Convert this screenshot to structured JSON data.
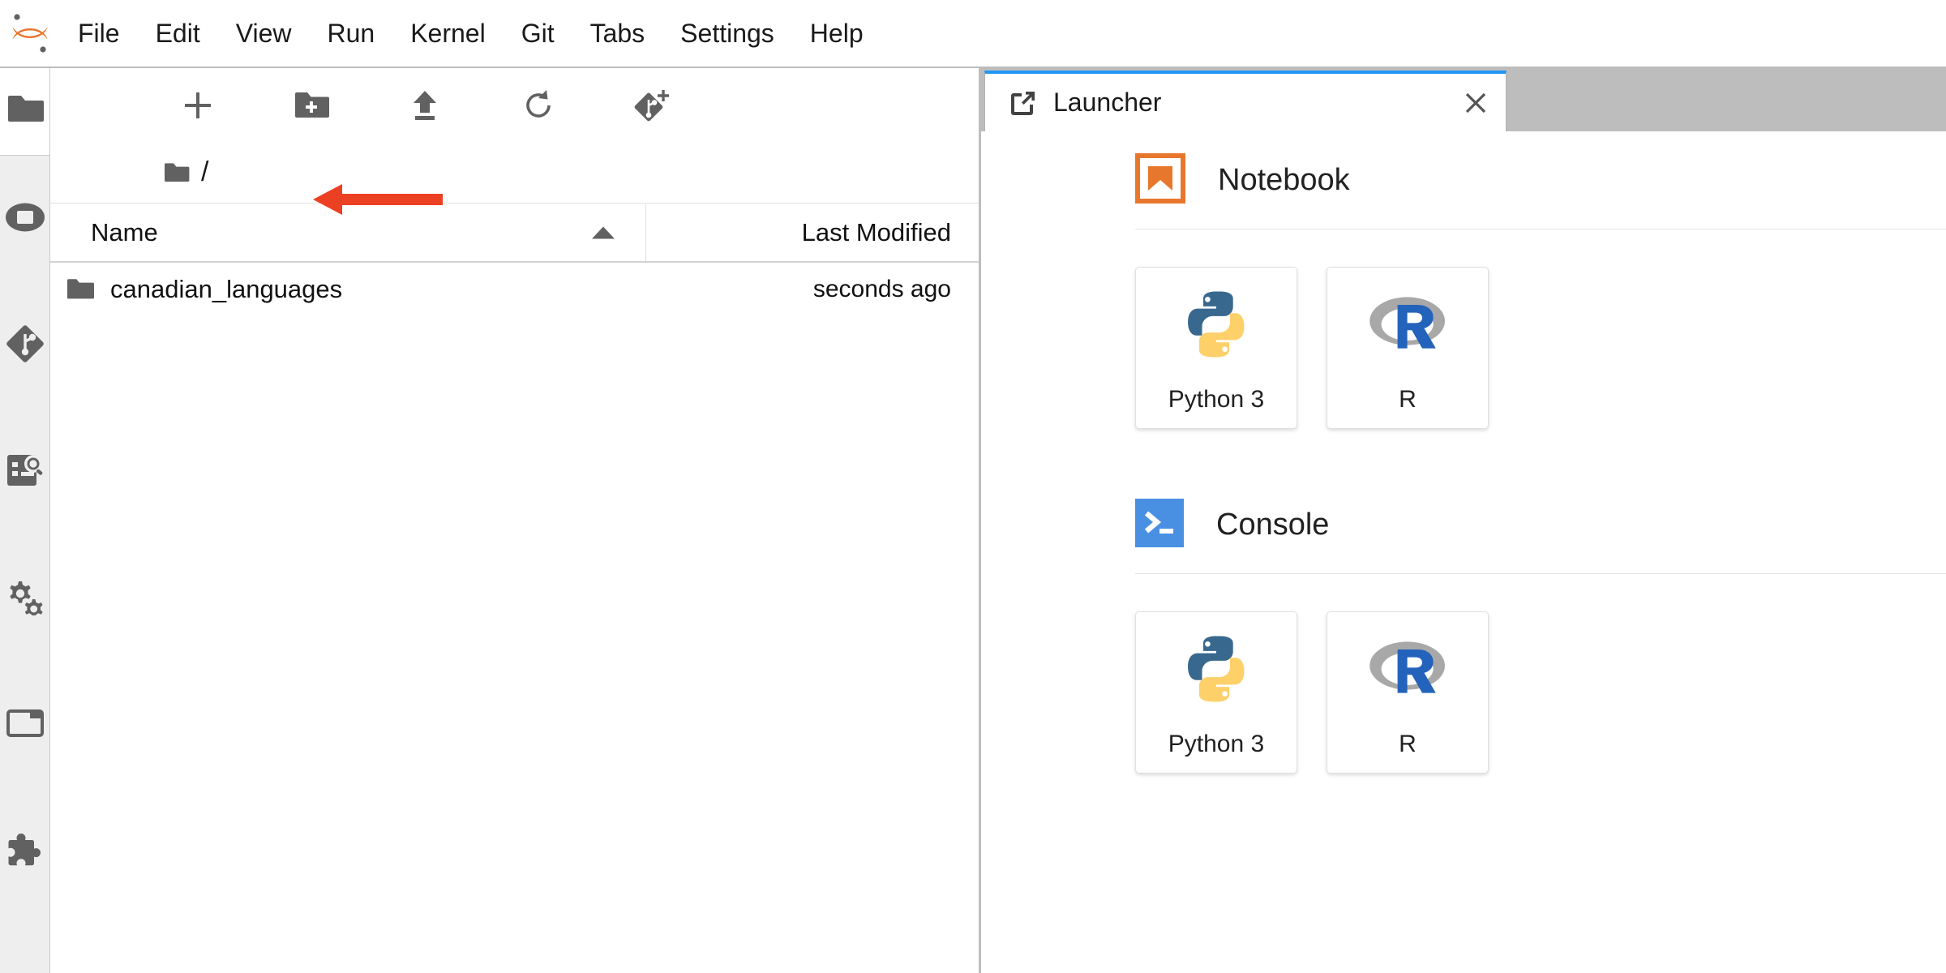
{
  "app": {
    "name": "JupyterLab",
    "logo_color": "#e8772e"
  },
  "menubar": {
    "items": [
      {
        "label": "File"
      },
      {
        "label": "Edit"
      },
      {
        "label": "View"
      },
      {
        "label": "Run"
      },
      {
        "label": "Kernel"
      },
      {
        "label": "Git"
      },
      {
        "label": "Tabs"
      },
      {
        "label": "Settings"
      },
      {
        "label": "Help"
      }
    ]
  },
  "activitybar": {
    "items": [
      {
        "name": "file-browser",
        "icon": "folder-icon",
        "active": true
      },
      {
        "name": "running-terminals",
        "icon": "running-icon",
        "active": false
      },
      {
        "name": "git",
        "icon": "git-icon",
        "active": false
      },
      {
        "name": "debugger",
        "icon": "table-of-contents-search-icon",
        "active": false
      },
      {
        "name": "property-inspector",
        "icon": "gear-icon",
        "active": false
      },
      {
        "name": "tab-manager",
        "icon": "tab-icon",
        "active": false
      },
      {
        "name": "extension-manager",
        "icon": "puzzle-icon",
        "active": false
      }
    ]
  },
  "filebrowser": {
    "toolbar": [
      {
        "name": "new-launcher",
        "icon": "plus-icon",
        "title": "New Launcher"
      },
      {
        "name": "new-folder",
        "icon": "new-folder-icon",
        "title": "New Folder"
      },
      {
        "name": "upload",
        "icon": "upload-icon",
        "title": "Upload Files"
      },
      {
        "name": "refresh",
        "icon": "refresh-icon",
        "title": "Refresh File List"
      },
      {
        "name": "git-clone",
        "icon": "git-clone-icon",
        "title": "Git Clone"
      }
    ],
    "breadcrumb": {
      "home_icon": "folder-icon",
      "path": "/"
    },
    "columns": {
      "name": "Name",
      "last_modified": "Last Modified",
      "sort_direction": "ascending"
    },
    "rows": [
      {
        "icon": "folder-icon",
        "name": "canadian_languages",
        "last_modified": "seconds ago",
        "annotated": true
      }
    ]
  },
  "dock": {
    "tabs": [
      {
        "label": "Launcher",
        "icon": "launcher-icon",
        "close_icon": "close-icon",
        "active": true
      }
    ]
  },
  "launcher": {
    "sections": [
      {
        "title": "Notebook",
        "icon": "notebook-icon",
        "cards": [
          {
            "label": "Python 3",
            "icon": "python-icon"
          },
          {
            "label": "R",
            "icon": "r-icon"
          }
        ]
      },
      {
        "title": "Console",
        "icon": "console-icon",
        "cards": [
          {
            "label": "Python 3",
            "icon": "python-icon"
          },
          {
            "label": "R",
            "icon": "r-icon"
          }
        ]
      }
    ]
  },
  "annotation": {
    "arrow_color": "#ec4023",
    "points_to": "canadian_languages"
  },
  "colors": {
    "accent_blue": "#2196f3",
    "notebook_orange": "#e8772e",
    "console_blue": "#4a90e2",
    "python_blue": "#39688f",
    "python_yellow": "#fdd06a",
    "r_blue": "#2463bc",
    "r_grey": "#a8a8a8",
    "icon_grey": "#616161",
    "dock_grey": "#bdbdbd"
  }
}
